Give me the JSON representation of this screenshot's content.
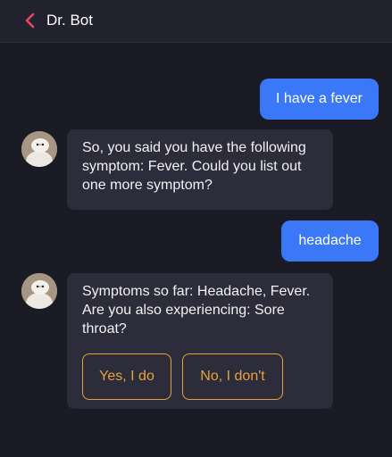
{
  "header": {
    "back_icon": "chevron-left-icon",
    "title": "Dr. Bot"
  },
  "messages": [
    {
      "sender": "user",
      "text": "I have a fever"
    },
    {
      "sender": "bot",
      "text": "So, you said you have the following symptom: Fever. Could you list out one more symptom?"
    },
    {
      "sender": "user",
      "text": "headache"
    },
    {
      "sender": "bot",
      "text": "Symptoms so far: Headache, Fever. Are you also experiencing: Sore throat?",
      "options": [
        "Yes, I do",
        "No, I don't"
      ]
    }
  ],
  "colors": {
    "background": "#1b1b25",
    "header": "#22222e",
    "user_bubble": "#3b78f7",
    "bot_bubble": "#2c2c3a",
    "accent": "#e8a23c",
    "back_icon": "#e8475f"
  }
}
